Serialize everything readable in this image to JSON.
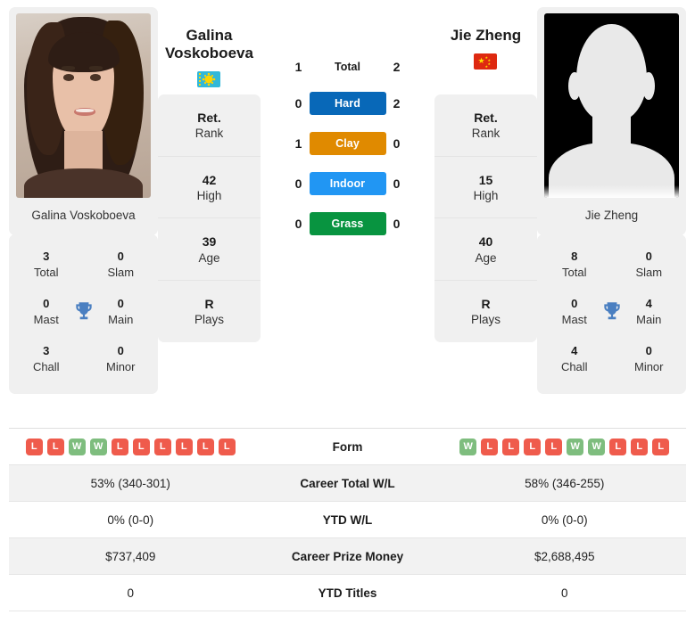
{
  "players": {
    "left": {
      "name": "Galina Voskoboeva",
      "display_name_line1": "Galina",
      "display_name_line2": "Voskoboeva",
      "photo_caption": "Galina Voskoboeva",
      "flag": "kazakhstan-flag",
      "stats": [
        {
          "value": "Ret.",
          "label": "Rank"
        },
        {
          "value": "42",
          "label": "High"
        },
        {
          "value": "39",
          "label": "Age"
        },
        {
          "value": "R",
          "label": "Plays"
        }
      ],
      "titles": [
        {
          "value": "3",
          "label": "Total"
        },
        {
          "value": "0",
          "label": "Slam"
        },
        {
          "value": "0",
          "label": "Mast"
        },
        {
          "value": "0",
          "label": "Main"
        },
        {
          "value": "3",
          "label": "Chall"
        },
        {
          "value": "0",
          "label": "Minor"
        }
      ],
      "form": [
        "L",
        "L",
        "W",
        "W",
        "L",
        "L",
        "L",
        "L",
        "L",
        "L"
      ],
      "career_total_wl": "53% (340-301)",
      "ytd_wl": "0% (0-0)",
      "career_prize_money": "$737,409",
      "ytd_titles": "0"
    },
    "right": {
      "name": "Jie Zheng",
      "display_name_line1": "Jie Zheng",
      "display_name_line2": "",
      "photo_caption": "Jie Zheng",
      "flag": "china-flag",
      "stats": [
        {
          "value": "Ret.",
          "label": "Rank"
        },
        {
          "value": "15",
          "label": "High"
        },
        {
          "value": "40",
          "label": "Age"
        },
        {
          "value": "R",
          "label": "Plays"
        }
      ],
      "titles": [
        {
          "value": "8",
          "label": "Total"
        },
        {
          "value": "0",
          "label": "Slam"
        },
        {
          "value": "0",
          "label": "Mast"
        },
        {
          "value": "4",
          "label": "Main"
        },
        {
          "value": "4",
          "label": "Chall"
        },
        {
          "value": "0",
          "label": "Minor"
        }
      ],
      "form": [
        "W",
        "L",
        "L",
        "L",
        "L",
        "W",
        "W",
        "L",
        "L",
        "L"
      ],
      "career_total_wl": "58% (346-255)",
      "ytd_wl": "0% (0-0)",
      "career_prize_money": "$2,688,495",
      "ytd_titles": "0"
    }
  },
  "head_to_head": {
    "total": {
      "label": "Total",
      "left": "1",
      "right": "2"
    },
    "surfaces": [
      {
        "label": "Hard",
        "left": "0",
        "right": "2",
        "color": "#0868b8"
      },
      {
        "label": "Clay",
        "left": "1",
        "right": "0",
        "color": "#e08a00"
      },
      {
        "label": "Indoor",
        "left": "0",
        "right": "0",
        "color": "#2196f3"
      },
      {
        "label": "Grass",
        "left": "0",
        "right": "0",
        "color": "#089440"
      }
    ]
  },
  "table": {
    "rows": [
      {
        "label": "Form",
        "type": "form"
      },
      {
        "label": "Career Total W/L",
        "type": "text",
        "left": "53% (340-301)",
        "right": "58% (346-255)"
      },
      {
        "label": "YTD W/L",
        "type": "text",
        "left": "0% (0-0)",
        "right": "0% (0-0)"
      },
      {
        "label": "Career Prize Money",
        "type": "text",
        "left": "$737,409",
        "right": "$2,688,495"
      },
      {
        "label": "YTD Titles",
        "type": "text",
        "left": "0",
        "right": "0"
      }
    ]
  },
  "colors": {
    "win": "#7ebd7e",
    "loss": "#ef5b4c",
    "trophy": "#4a7fc1",
    "card_bg": "#f0f0f0",
    "row_alt": "#f2f2f2"
  }
}
